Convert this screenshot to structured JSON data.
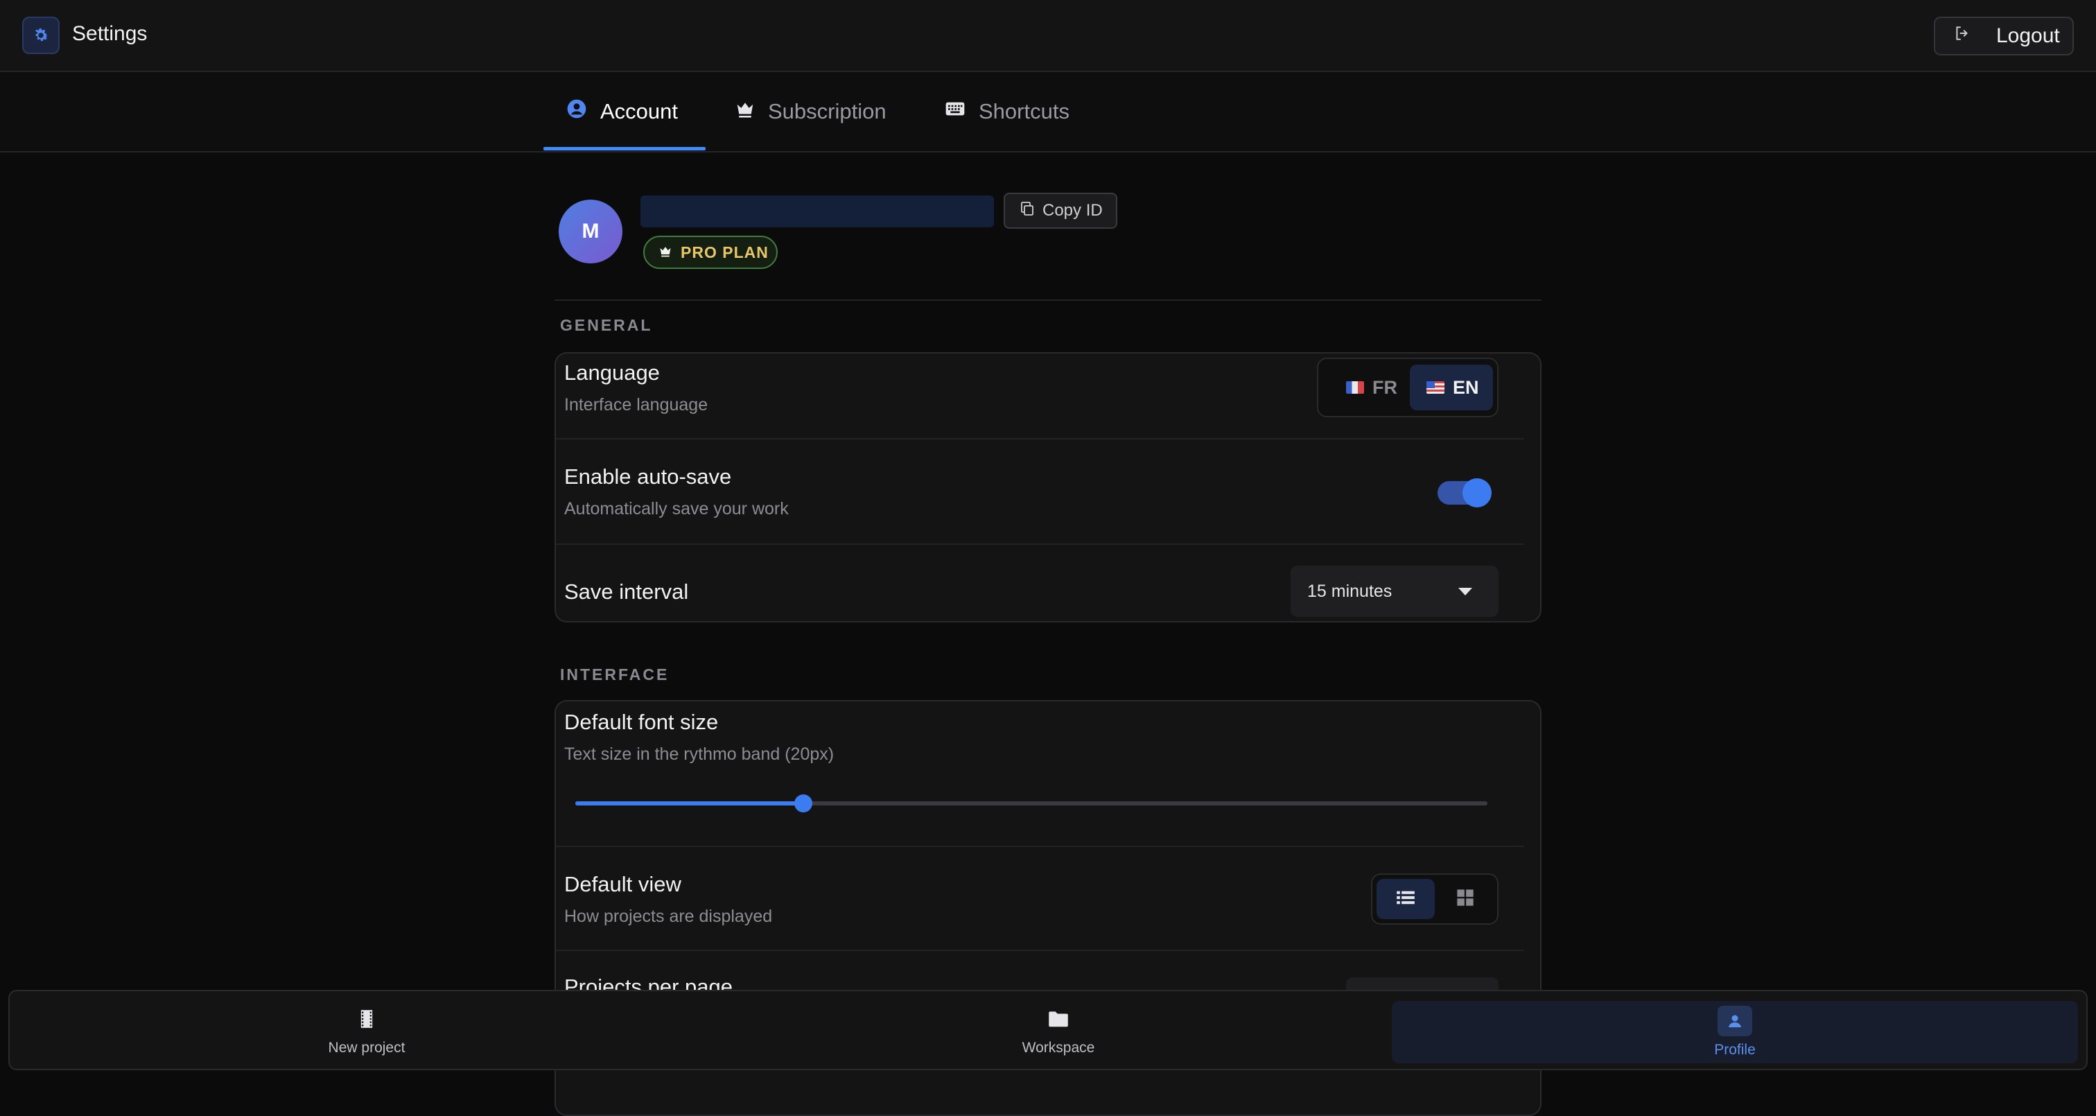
{
  "header": {
    "title": "Settings",
    "logout_label": "Logout"
  },
  "tabs": [
    {
      "label": "Account",
      "icon": "user-circle-icon",
      "active": true
    },
    {
      "label": "Subscription",
      "icon": "crown-icon",
      "active": false
    },
    {
      "label": "Shortcuts",
      "icon": "keyboard-icon",
      "active": false
    }
  ],
  "profile": {
    "avatar_initial": "M",
    "copy_id_label": "Copy ID",
    "plan_badge": "PRO PLAN"
  },
  "general": {
    "section_label": "GENERAL",
    "language": {
      "title": "Language",
      "subtitle": "Interface language",
      "options": [
        "FR",
        "EN"
      ],
      "selected": "EN"
    },
    "autosave": {
      "title": "Enable auto-save",
      "subtitle": "Automatically save your work",
      "enabled": true
    },
    "save_interval": {
      "title": "Save interval",
      "value": "15 minutes"
    }
  },
  "interface": {
    "section_label": "INTERFACE",
    "font_size": {
      "title": "Default font size",
      "subtitle": "Text size in the rythmo band (20px)",
      "slider_fraction": 0.25
    },
    "default_view": {
      "title": "Default view",
      "subtitle": "How projects are displayed",
      "selected": "list"
    },
    "projects_per_page": {
      "title": "Projects per page"
    }
  },
  "bottom_nav": [
    {
      "label": "New project",
      "icon": "film-icon",
      "active": false
    },
    {
      "label": "Workspace",
      "icon": "folder-icon",
      "active": false
    },
    {
      "label": "Profile",
      "icon": "user-icon",
      "active": true
    }
  ],
  "colors": {
    "accent": "#3d7cf0",
    "badge_text": "#e8c66a",
    "badge_border": "#3f7a3f"
  }
}
